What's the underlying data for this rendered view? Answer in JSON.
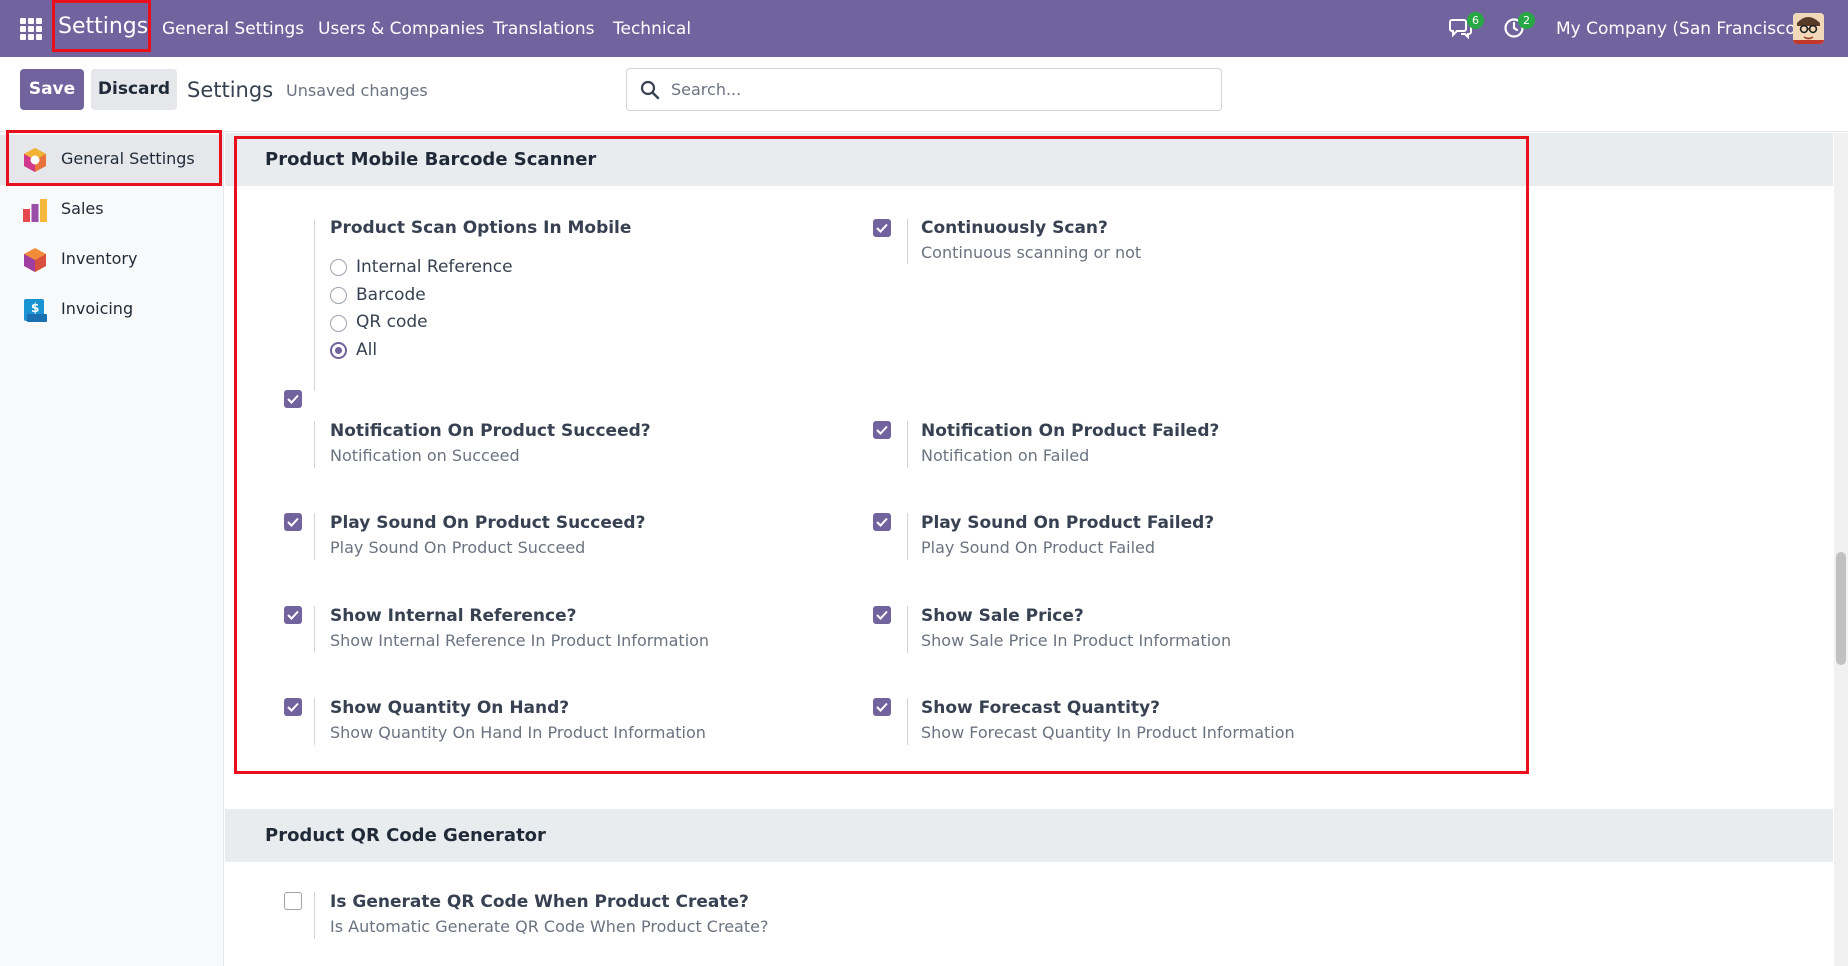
{
  "navbar": {
    "app_title": "Settings",
    "menu": [
      "General Settings",
      "Users & Companies",
      "Translations",
      "Technical"
    ],
    "chat_count": "6",
    "activity_count": "2",
    "company": "My Company (San Francisco)"
  },
  "control": {
    "save_label": "Save",
    "discard_label": "Discard",
    "title": "Settings",
    "status": "Unsaved changes",
    "search_placeholder": "Search..."
  },
  "sidebar": {
    "items": [
      {
        "label": "General Settings",
        "icon": "settings-app-icon",
        "active": true
      },
      {
        "label": "Sales",
        "icon": "sales-app-icon"
      },
      {
        "label": "Inventory",
        "icon": "inventory-app-icon"
      },
      {
        "label": "Invoicing",
        "icon": "invoicing-app-icon"
      }
    ]
  },
  "sections": [
    {
      "title": "Product Mobile Barcode Scanner",
      "scan_options": {
        "title": "Product Scan Options In Mobile",
        "options": [
          "Internal Reference",
          "Barcode",
          "QR code",
          "All"
        ],
        "selected": "All"
      },
      "settings": [
        {
          "title": "Continuously Scan?",
          "desc": "Continuous scanning or not",
          "checked": true
        },
        {
          "title": "Notification On Product Succeed?",
          "desc": "Notification on Succeed",
          "checked": true
        },
        {
          "title": "Notification On Product Failed?",
          "desc": "Notification on Failed",
          "checked": true
        },
        {
          "title": "Play Sound On Product Succeed?",
          "desc": "Play Sound On Product Succeed",
          "checked": true
        },
        {
          "title": "Play Sound On Product Failed?",
          "desc": "Play Sound On Product Failed",
          "checked": true
        },
        {
          "title": "Show Internal Reference?",
          "desc": "Show Internal Reference In Product Information",
          "checked": true
        },
        {
          "title": "Show Sale Price?",
          "desc": "Show Sale Price In Product Information",
          "checked": true
        },
        {
          "title": "Show Quantity On Hand?",
          "desc": "Show Quantity On Hand In Product Information",
          "checked": true
        },
        {
          "title": "Show Forecast Quantity?",
          "desc": "Show Forecast Quantity In Product Information",
          "checked": true
        }
      ]
    },
    {
      "title": "Product QR Code Generator",
      "settings": [
        {
          "title": "Is Generate QR Code When Product Create?",
          "desc": "Is Automatic Generate QR Code When Product Create?",
          "checked": false
        }
      ]
    }
  ],
  "colors": {
    "brand": "#71639e",
    "highlight": "#e8101b",
    "badge": "#28a745"
  }
}
